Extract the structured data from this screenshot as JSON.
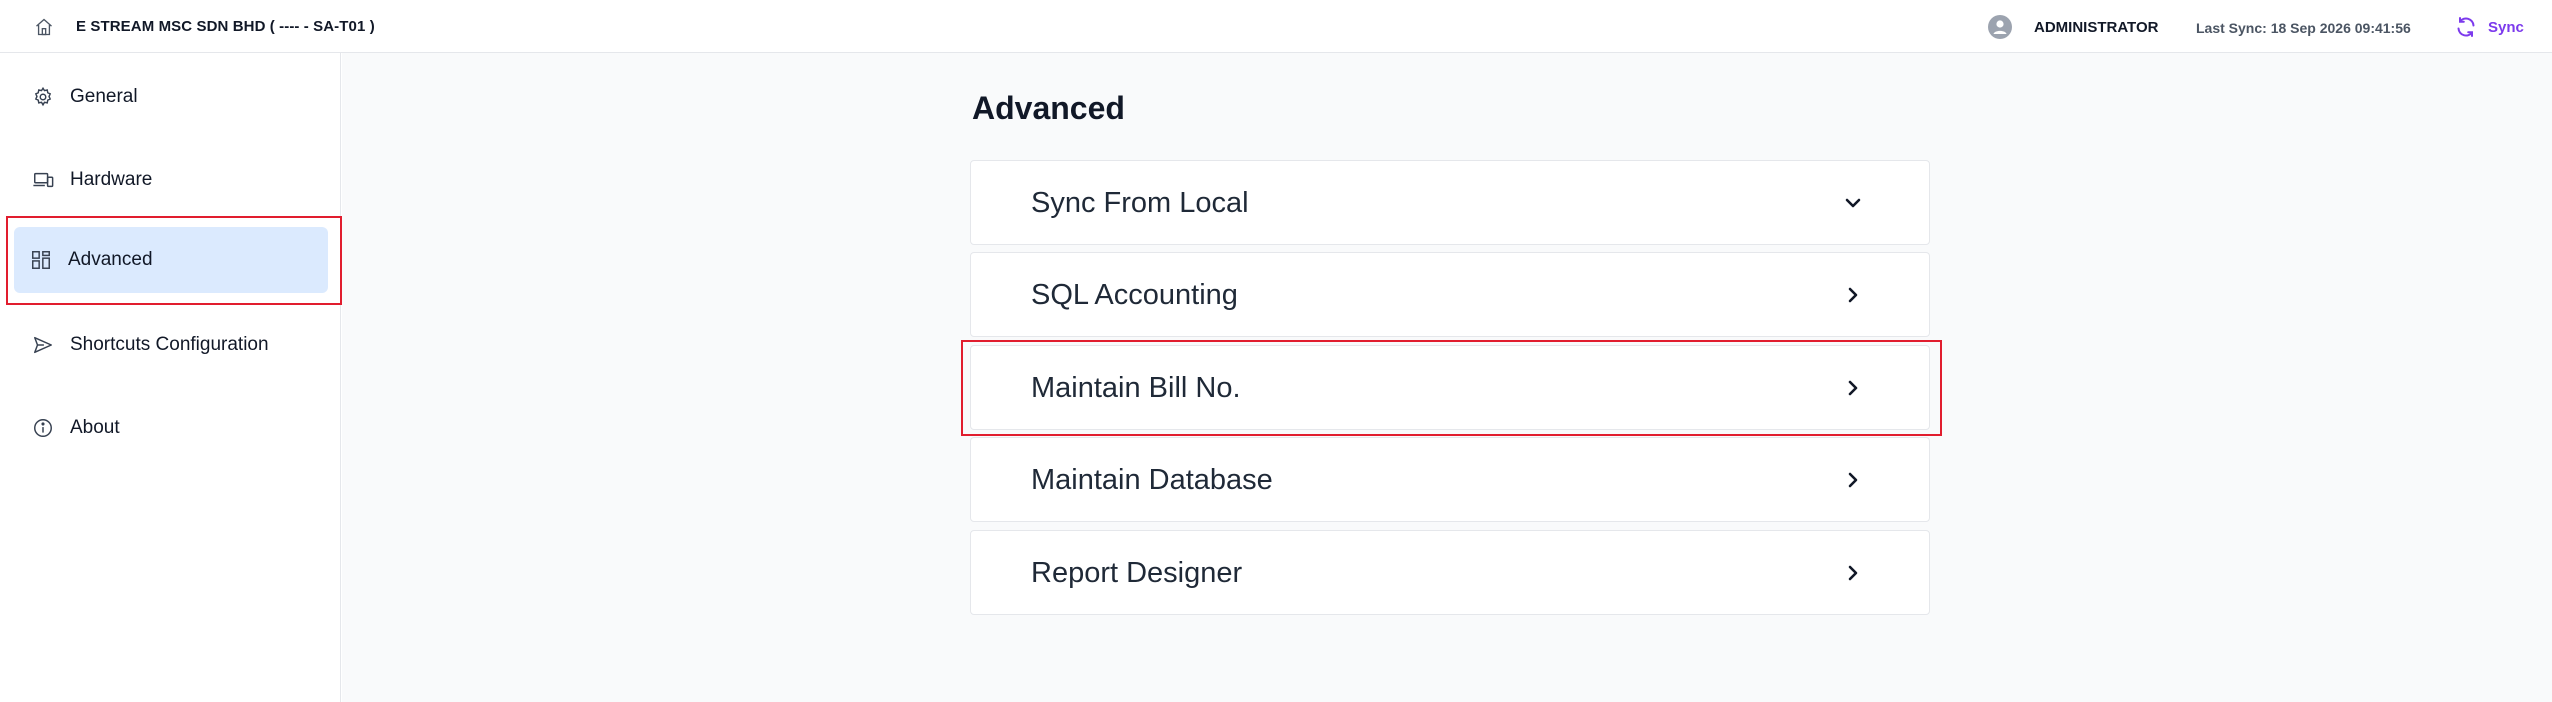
{
  "header": {
    "company": "E STREAM MSC SDN BHD ( ---- - SA-T01 )",
    "username": "ADMINISTRATOR",
    "last_sync": "Last Sync: 18 Sep 2026 09:41:56",
    "sync_label": "Sync"
  },
  "sidebar": {
    "items": [
      {
        "label": "General",
        "icon": "gear-icon"
      },
      {
        "label": "Hardware",
        "icon": "devices-icon"
      },
      {
        "label": "Advanced",
        "icon": "dashboard-icon",
        "active": true
      },
      {
        "label": "Shortcuts Configuration",
        "icon": "send-icon"
      },
      {
        "label": "About",
        "icon": "info-icon"
      }
    ]
  },
  "main": {
    "title": "Advanced",
    "sections": [
      {
        "label": "Sync From Local",
        "expanded": true
      },
      {
        "label": "SQL Accounting",
        "expanded": false
      },
      {
        "label": "Maintain Bill No.",
        "expanded": false
      },
      {
        "label": "Maintain Database",
        "expanded": false
      },
      {
        "label": "Report Designer",
        "expanded": false
      }
    ]
  },
  "colors": {
    "accent": "#7c3aed",
    "active_bg": "#dbeafe",
    "highlight": "#e11d2e",
    "main_bg": "#f9fafb"
  }
}
